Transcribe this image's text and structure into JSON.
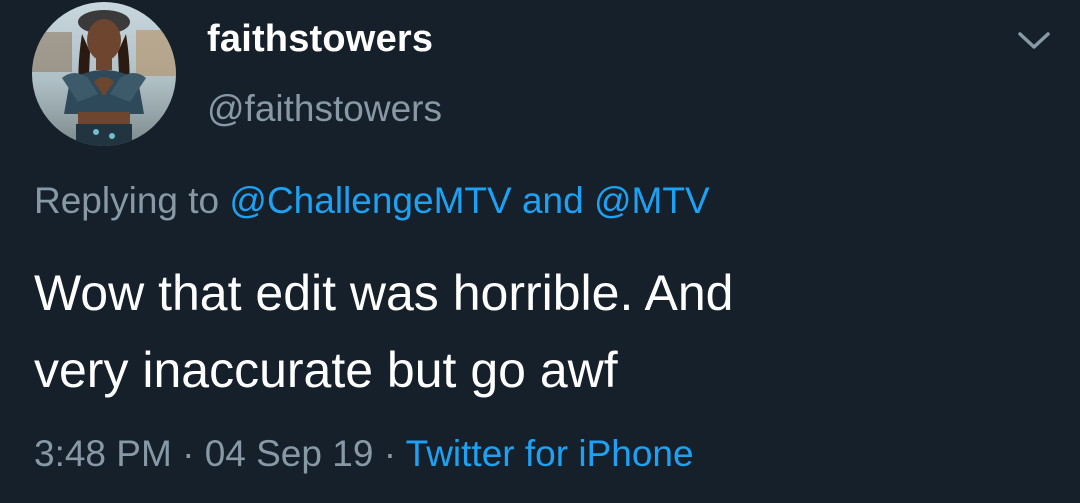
{
  "user": {
    "display_name": "faithstowers",
    "handle": "@faithstowers"
  },
  "reply": {
    "prefix": "Replying to",
    "mention_1": "@ChallengeMTV",
    "conjunction": "and",
    "mention_2": "@MTV"
  },
  "tweet": {
    "line_1": "Wow that edit was horrible. And",
    "line_2": "very inaccurate but go awf"
  },
  "meta": {
    "time": "3:48 PM",
    "separator": "·",
    "date": "04 Sep 19",
    "source": "Twitter for iPhone"
  },
  "icons": {
    "menu": "chevron-down-icon",
    "avatar": "avatar"
  },
  "colors": {
    "background": "#15202b",
    "text_primary": "#ffffff",
    "text_secondary": "#8899a6",
    "link": "#1da1f2"
  }
}
